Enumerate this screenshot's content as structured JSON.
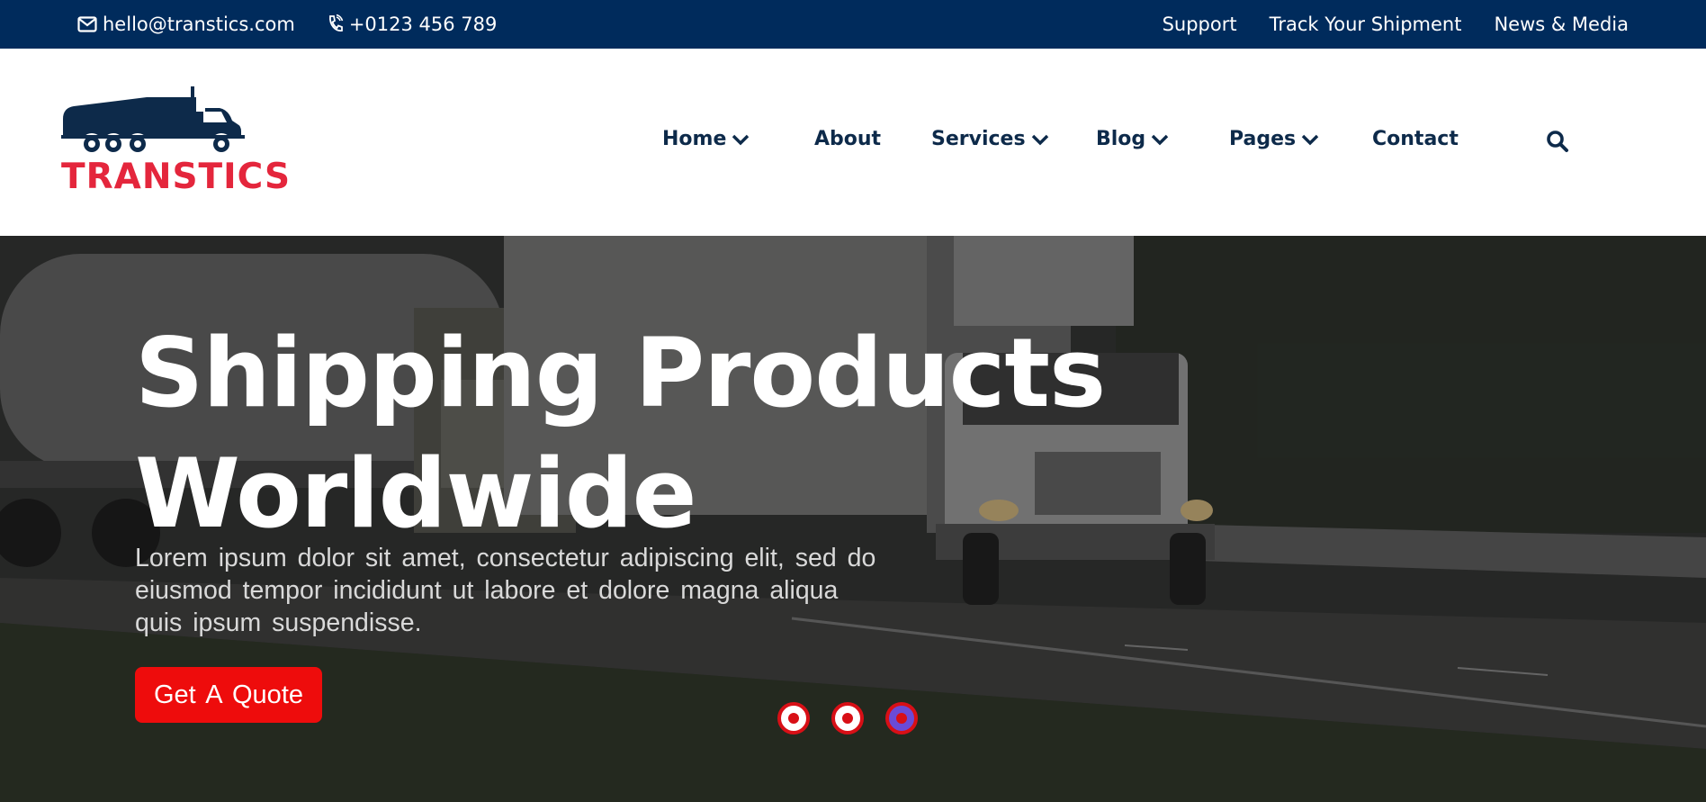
{
  "topbar": {
    "email": "hello@transtics.com",
    "phone": "+0123 456 789",
    "links": [
      "Support",
      "Track Your Shipment",
      "News & Media"
    ],
    "background": "#002b5c"
  },
  "logo": {
    "text": "TRANSTICS",
    "truck_color": "#0d2a4a",
    "text_color": "#e4263c"
  },
  "nav": {
    "items": [
      {
        "label": "Home",
        "has_dropdown": true
      },
      {
        "label": "About",
        "has_dropdown": false
      },
      {
        "label": "Services",
        "has_dropdown": true
      },
      {
        "label": "Blog",
        "has_dropdown": true
      },
      {
        "label": "Pages",
        "has_dropdown": true
      },
      {
        "label": "Contact",
        "has_dropdown": false
      }
    ],
    "search_icon": "search-icon",
    "color": "#0d2a4a"
  },
  "hero": {
    "title_line1": "Shipping Products",
    "title_line2": "Worldwide",
    "subtitle": "Lorem ipsum dolor sit amet, consectetur adipiscing elit, sed do eiusmod tempor incididunt ut labore et dolore magna aliqua quis ipsum suspendisse.",
    "cta_label": "Get A Quote",
    "cta_color": "#ee0c0c",
    "slides_count": 3,
    "active_slide": 3
  }
}
